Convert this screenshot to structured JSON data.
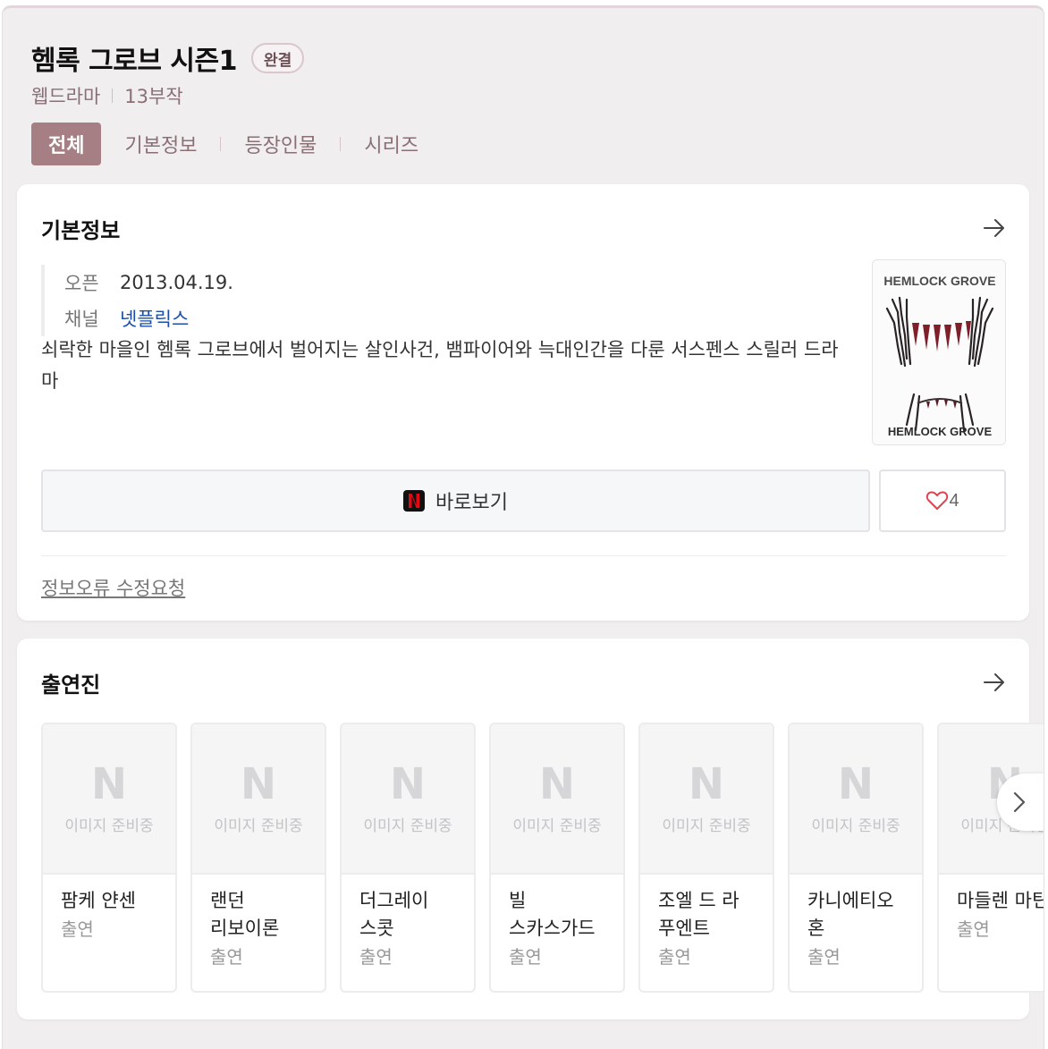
{
  "header": {
    "title": "헴록 그로브 시즌1",
    "badge": "완결",
    "genre": "웹드라마",
    "episodes": "13부작"
  },
  "tabs": [
    {
      "label": "전체",
      "active": true
    },
    {
      "label": "기본정보",
      "active": false
    },
    {
      "label": "등장인물",
      "active": false
    },
    {
      "label": "시리즈",
      "active": false
    }
  ],
  "basic_info": {
    "section_title": "기본정보",
    "open_label": "오픈",
    "open_value": "2013.04.19.",
    "channel_label": "채널",
    "channel_value": "넷플릭스",
    "description": "쇠락한 마을인 헴록 그로브에서 벌어지는 살인사건, 뱀파이어와 늑대인간을 다룬 서스펜스 스릴러 드라마",
    "poster_title": "HEMLOCK GROVE",
    "watch_label": "바로보기",
    "like_count": "4",
    "report_label": "정보오류 수정요청"
  },
  "cast": {
    "section_title": "출연진",
    "placeholder_text": "이미지 준비중",
    "placeholder_letter": "N",
    "members": [
      {
        "name": "팜케 얀센",
        "role": "출연"
      },
      {
        "name": "랜던 리보이론",
        "role": "출연"
      },
      {
        "name": "더그레이 스콧",
        "role": "출연"
      },
      {
        "name": "빌 스카스가드",
        "role": "출연"
      },
      {
        "name": "조엘 드 라 푸엔트",
        "role": "출연"
      },
      {
        "name": "카니에티오 혼",
        "role": "출연"
      },
      {
        "name": "마들렌 마틴",
        "role": "출연"
      }
    ]
  },
  "colors": {
    "accent": "#a57f84",
    "link": "#1b4fa7",
    "heart": "#e0424f",
    "netflix_red": "#e50914"
  }
}
